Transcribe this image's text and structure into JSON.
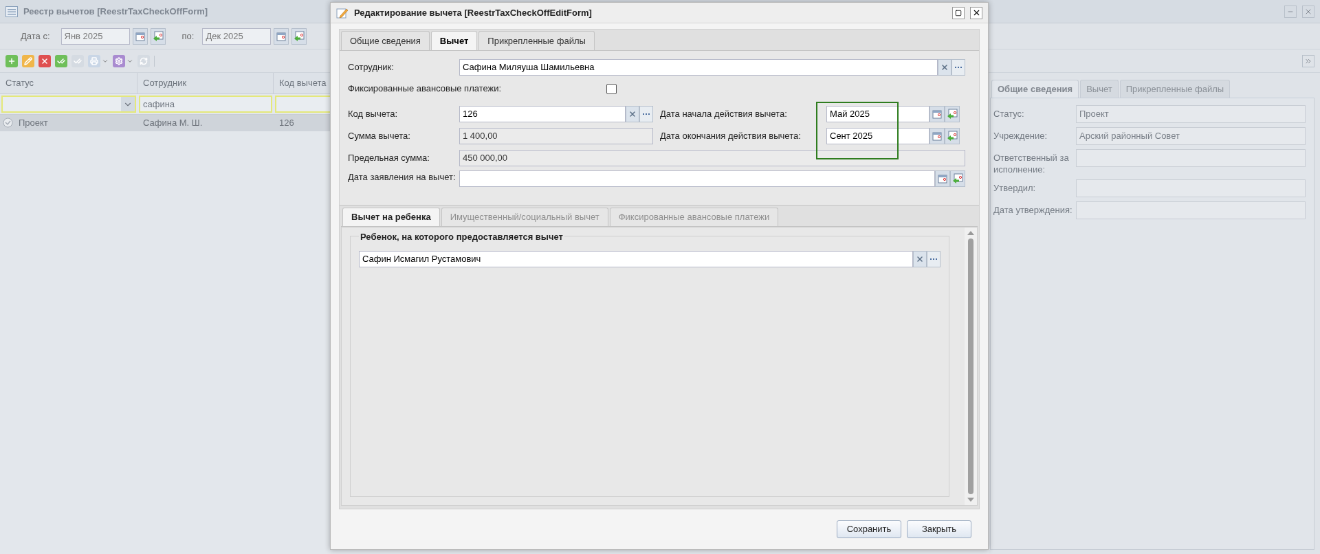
{
  "background_window": {
    "title": "Реестр вычетов [ReestrTaxCheckOffForm]",
    "date_from": {
      "label": "Дата с:",
      "value": "Янв 2025"
    },
    "date_to": {
      "label": "по:",
      "value": "Дек 2025"
    },
    "grid": {
      "columns": [
        "Статус",
        "Сотрудник",
        "Код вычета"
      ],
      "filters": [
        {
          "kind": "select"
        },
        {
          "kind": "text",
          "value": "сафина"
        },
        {
          "kind": "text"
        }
      ],
      "rows": [
        {
          "selected": true,
          "cells": [
            "Проект",
            "Сафина М. Ш.",
            "126"
          ]
        }
      ]
    },
    "details": {
      "tabs": [
        {
          "label": "Общие сведения",
          "selected": true
        },
        {
          "label": "Вычет",
          "selected": false
        },
        {
          "label": "Прикрепленные файлы",
          "selected": false
        }
      ],
      "fields": [
        {
          "label": "Статус:",
          "value": "Проект"
        },
        {
          "label": "Учреждение:",
          "value": "Арский районный Совет"
        },
        {
          "label": "Ответственный за исполнение:"
        },
        {
          "label": "Утвердил:"
        },
        {
          "label": "Дата утверждения:"
        }
      ]
    }
  },
  "dialog": {
    "title": "Редактирование вычета [ReestrTaxCheckOffEditForm]",
    "tabs": [
      {
        "label": "Общие сведения",
        "selected": false
      },
      {
        "label": "Вычет",
        "selected": true
      },
      {
        "label": "Прикрепленные файлы",
        "selected": false
      }
    ],
    "employee": {
      "label": "Сотрудник:",
      "value": "Сафина Миляуша Шамильевна"
    },
    "fixed_advance": {
      "label": "Фиксированные авансовые платежи:",
      "checked": false
    },
    "deduction_code": {
      "label": "Код вычета:",
      "value": "126"
    },
    "start_date": {
      "label": "Дата начала действия вычета:",
      "value": "Май 2025"
    },
    "amount": {
      "label": "Сумма вычета:",
      "value": "1 400,00"
    },
    "end_date": {
      "label": "Дата окончания действия вычета:",
      "value": "Сент 2025"
    },
    "limit": {
      "label": "Предельная сумма:",
      "value": "450 000,00"
    },
    "application_date": {
      "label": "Дата заявления на вычет:"
    },
    "sub_tabs": [
      {
        "label": "Вычет на ребенка",
        "selected": true,
        "disabled": false
      },
      {
        "label": "Имущественный/социальный вычет",
        "selected": false,
        "disabled": true
      },
      {
        "label": "Фиксированные авансовые платежи",
        "selected": false,
        "disabled": true
      }
    ],
    "child_group": {
      "title": "Ребенок, на которого предоставляется вычет",
      "value": "Сафин Исмагил Рустамович"
    },
    "buttons": [
      "Сохранить",
      "Закрыть"
    ]
  }
}
